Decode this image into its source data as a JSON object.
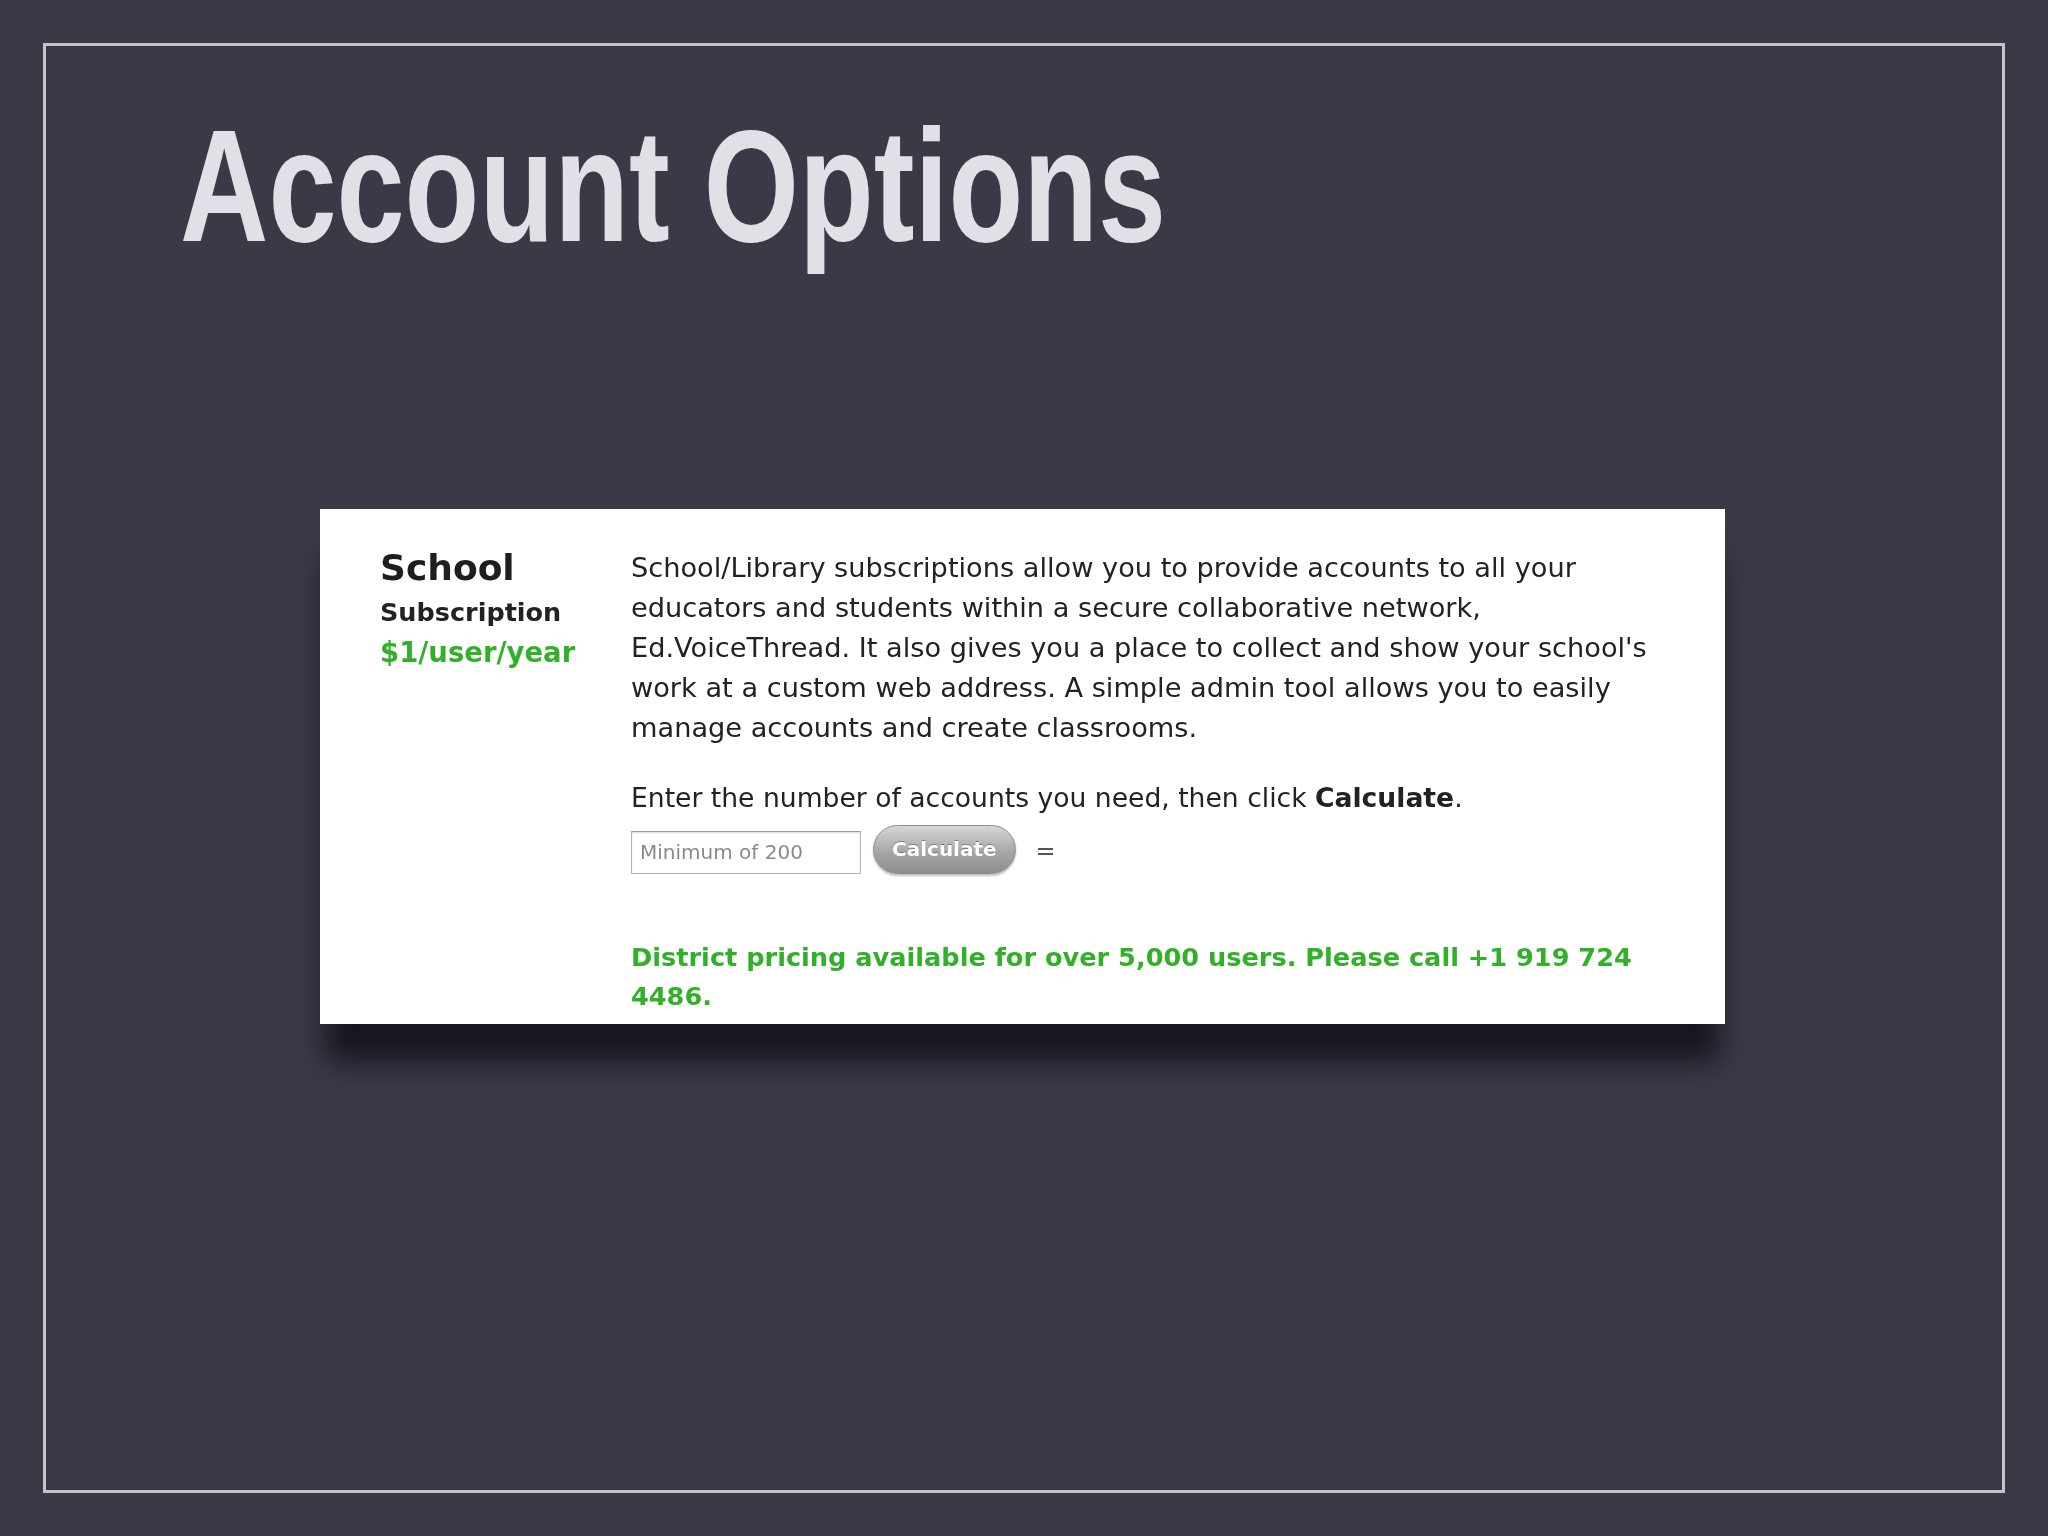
{
  "slide": {
    "title": "Account Options"
  },
  "plan_card": {
    "name": "School",
    "type": "Subscription",
    "price": "$1/user/year",
    "description": "School/Library subscriptions allow you to provide accounts to all your educators and students within a secure collaborative network, Ed.VoiceThread. It also gives you a place to collect and show your school's work at a custom web address. A simple admin tool allows you to easily manage accounts and create classrooms.",
    "instruction": "Enter the number of accounts you need, then click **Calculate**.",
    "accounts_field": {
      "placeholder": "Minimum of 200"
    },
    "calculate_button": {
      "label": "Calculate"
    },
    "equals_sign": "=",
    "district_note": "District pricing available for over 5,000 users. Please call +1 919 724 4486."
  }
}
